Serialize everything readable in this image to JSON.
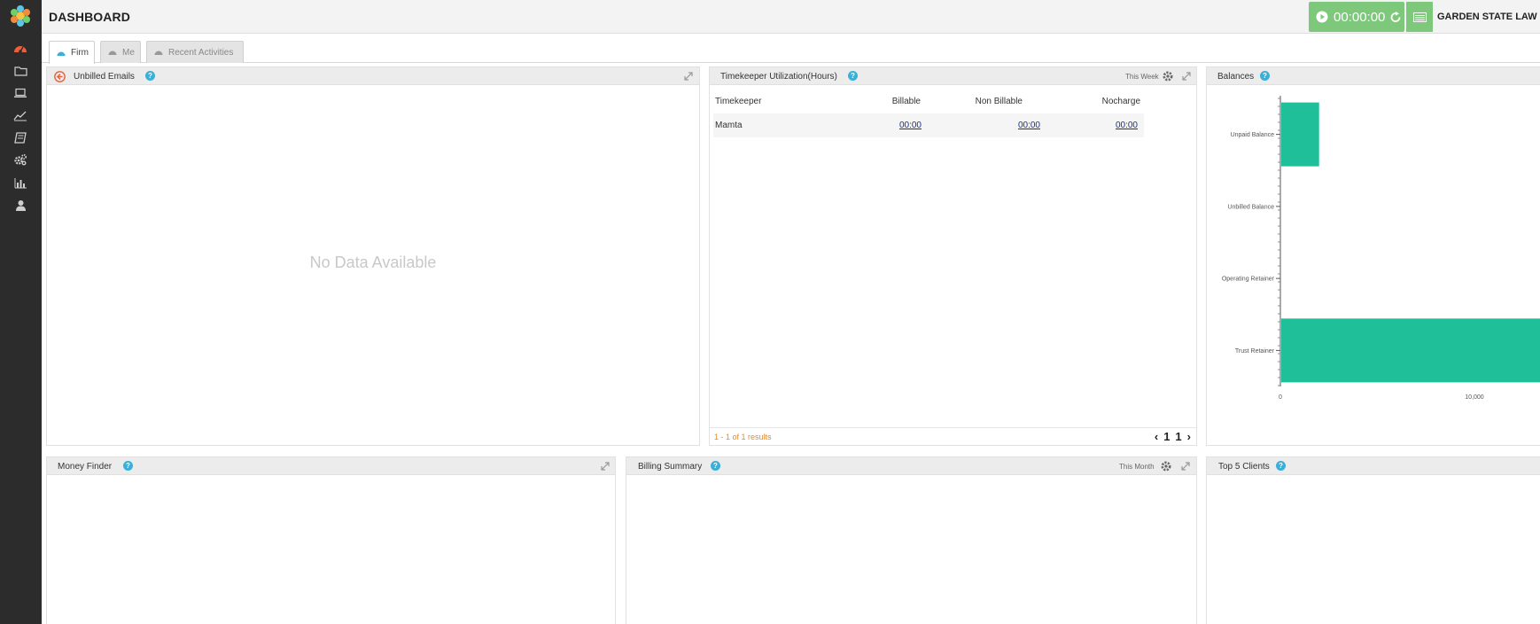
{
  "header": {
    "title": "DASHBOARD",
    "timer": "00:00:00",
    "firm_name": "GARDEN STATE LAW",
    "cut_text": "G"
  },
  "sidebar": {
    "items": [
      {
        "name": "dashboard-icon",
        "color": "#e8603c"
      },
      {
        "name": "folder-icon"
      },
      {
        "name": "laptop-icon"
      },
      {
        "name": "trend-chart-icon"
      },
      {
        "name": "book-icon"
      },
      {
        "name": "settings-gears-icon"
      },
      {
        "name": "bar-chart-icon"
      },
      {
        "name": "user-icon"
      }
    ]
  },
  "tabs": [
    {
      "label": "Firm",
      "active": true
    },
    {
      "label": "Me",
      "active": false
    },
    {
      "label": "Recent Activities",
      "active": false
    }
  ],
  "panels": {
    "unbilled_emails": {
      "title": "Unbilled Emails",
      "empty_text": "No Data Available"
    },
    "timekeeper": {
      "title": "Timekeeper Utilization(Hours)",
      "period": "This Week",
      "columns": [
        "Timekeeper",
        "Billable",
        "Non Billable",
        "Nocharge"
      ],
      "rows": [
        {
          "timekeeper": "Mamta",
          "billable": "00:00",
          "non_billable": "00:00",
          "nocharge": "00:00"
        }
      ],
      "results": "1 - 1 of 1 results",
      "page_current": "1",
      "page_total": "1"
    },
    "balances": {
      "title": "Balances"
    },
    "money_finder": {
      "title": "Money Finder"
    },
    "billing_summary": {
      "title": "Billing Summary",
      "period": "This Month"
    },
    "top_clients": {
      "title": "Top 5 Clients"
    }
  },
  "chart_data": {
    "type": "bar",
    "orientation": "horizontal",
    "categories": [
      "Unpaid Balance",
      "Unbilled Balance",
      "Operating Retainer",
      "Trust Retainer"
    ],
    "values": [
      1950,
      0,
      0,
      13500
    ],
    "x_ticks": [
      "0",
      "10,000"
    ],
    "xlim": [
      0,
      13500
    ],
    "color": "#1fbf99"
  },
  "colors": {
    "accent_green": "#7dc87a",
    "help_blue": "#3ab0d8",
    "bar_teal": "#1fbf99",
    "results_orange": "#e58a2e"
  }
}
